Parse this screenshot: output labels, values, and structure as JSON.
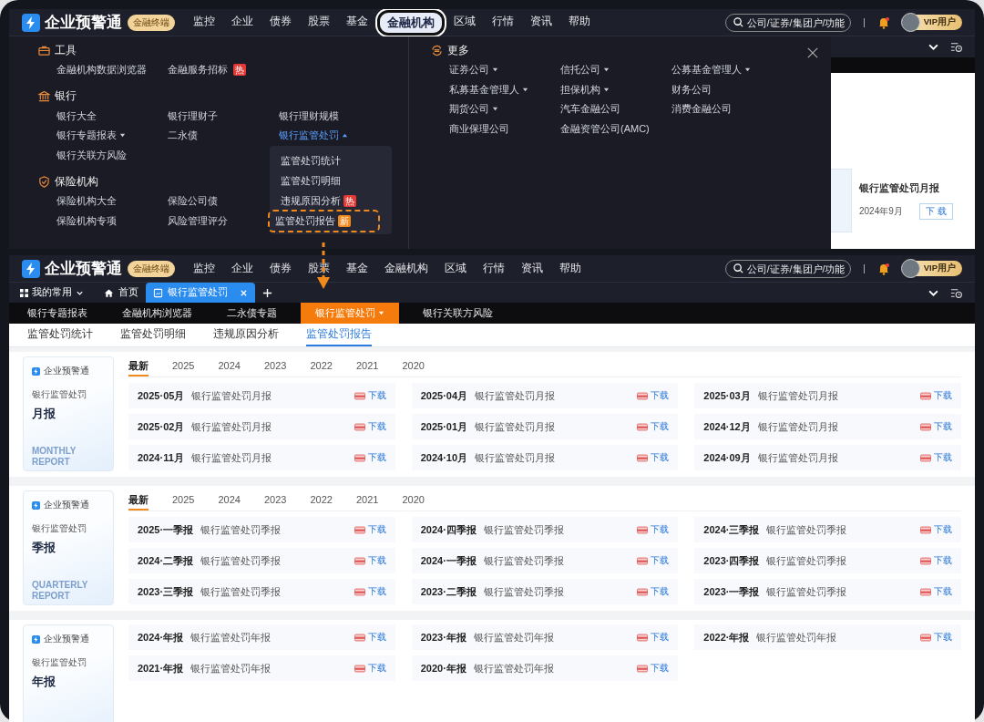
{
  "screens": [
    {
      "header": {
        "logo_text": "企业预警通",
        "badge": "金融终端",
        "nav": [
          {
            "label": "监控",
            "selected": false
          },
          {
            "label": "企业",
            "selected": false
          },
          {
            "label": "债券",
            "selected": false
          },
          {
            "label": "股票",
            "selected": false
          },
          {
            "label": "基金",
            "selected": false
          },
          {
            "label": "金融机构",
            "selected": true
          },
          {
            "label": "区域",
            "selected": false
          },
          {
            "label": "行情",
            "selected": false
          },
          {
            "label": "资讯",
            "selected": false
          },
          {
            "label": "帮助",
            "selected": false
          }
        ],
        "search_placeholder": "公司/证券/集团户/功能",
        "unread": true,
        "user": "VIP用户"
      },
      "mega_menu": {
        "groups": [
          {
            "kind": "tools",
            "title": "工具",
            "rows": [
              [
                {
                  "label": "金融机构数据浏览器",
                  "dropdown": false,
                  "expanded": false
                },
                {
                  "label": "金融服务招标",
                  "dropdown": false,
                  "expanded": false,
                  "badge": {
                    "text": "热",
                    "kind": "hot"
                  }
                }
              ]
            ]
          },
          {
            "kind": "bank",
            "title": "银行",
            "rows": [
              [
                {
                  "label": "银行大全",
                  "dropdown": false,
                  "expanded": false
                },
                {
                  "label": "银行理财子",
                  "dropdown": false,
                  "expanded": false
                },
                {
                  "label": "银行理财规模",
                  "dropdown": false,
                  "expanded": false
                }
              ],
              [
                {
                  "label": "银行专题报表",
                  "dropdown": true,
                  "expanded": false
                },
                {
                  "label": "二永债",
                  "dropdown": false,
                  "expanded": false
                },
                {
                  "label": "银行监管处罚",
                  "dropdown": true,
                  "expanded": true,
                  "submenu": [
                    {
                      "label": "监管处罚统计",
                      "highlighted": false
                    },
                    {
                      "label": "监管处罚明细",
                      "highlighted": false
                    },
                    {
                      "label": "违规原因分析",
                      "highlighted": false,
                      "badge": {
                        "text": "热",
                        "kind": "hot"
                      }
                    },
                    {
                      "label": "监管处罚报告",
                      "highlighted": true,
                      "badge": {
                        "text": "新",
                        "kind": "new"
                      }
                    }
                  ]
                }
              ],
              [
                {
                  "label": "银行关联方风险",
                  "dropdown": false,
                  "expanded": false
                }
              ]
            ]
          },
          {
            "kind": "insurance",
            "title": "保险机构",
            "rows": [
              [
                {
                  "label": "保险机构大全",
                  "dropdown": false,
                  "expanded": false
                },
                {
                  "label": "保险公司债",
                  "dropdown": false,
                  "expanded": false
                }
              ],
              [
                {
                  "label": "保险机构专项",
                  "dropdown": false,
                  "expanded": false
                },
                {
                  "label": "风险管理评分",
                  "dropdown": false,
                  "expanded": false
                }
              ]
            ]
          }
        ],
        "more": {
          "title": "更多",
          "rows": [
            [
              {
                "label": "证券公司",
                "dropdown": true,
                "expanded": false
              },
              {
                "label": "信托公司",
                "dropdown": true,
                "expanded": false
              },
              {
                "label": "公募基金管理人",
                "dropdown": true,
                "expanded": false
              }
            ],
            [
              {
                "label": "私募基金管理人",
                "dropdown": true,
                "expanded": false
              },
              {
                "label": "担保机构",
                "dropdown": true,
                "expanded": false
              },
              {
                "label": "财务公司",
                "dropdown": false,
                "expanded": false
              }
            ],
            [
              {
                "label": "期货公司",
                "dropdown": true,
                "expanded": false
              },
              {
                "label": "汽车金融公司",
                "dropdown": false,
                "expanded": false
              },
              {
                "label": "消费金融公司",
                "dropdown": false,
                "expanded": false
              }
            ],
            [
              {
                "label": "商业保理公司",
                "dropdown": false,
                "expanded": false
              },
              {
                "label": "金融资管公司(AMC)",
                "dropdown": false,
                "expanded": false
              }
            ]
          ]
        }
      },
      "peek": {
        "title": "银行监管处罚月报",
        "date": "2024年9月",
        "button": "下 载"
      }
    },
    {
      "header": {
        "logo_text": "企业预警通",
        "badge": "金融终端",
        "nav": [
          {
            "label": "监控",
            "selected": false
          },
          {
            "label": "企业",
            "selected": false
          },
          {
            "label": "债券",
            "selected": false
          },
          {
            "label": "股票",
            "selected": false
          },
          {
            "label": "基金",
            "selected": false
          },
          {
            "label": "金融机构",
            "selected": false
          },
          {
            "label": "区域",
            "selected": false
          },
          {
            "label": "行情",
            "selected": false
          },
          {
            "label": "资讯",
            "selected": false
          },
          {
            "label": "帮助",
            "selected": false
          }
        ],
        "search_placeholder": "公司/证券/集团户/功能",
        "unread": true,
        "user": "VIP用户"
      },
      "tabbar": {
        "favorites": "我的常用",
        "tabs": [
          {
            "label": "首页",
            "kind": "home",
            "selected": false
          },
          {
            "label": "银行监管处罚",
            "kind": "page",
            "selected": true
          }
        ]
      },
      "subnav": [
        {
          "label": "银行专题报表",
          "selected": false,
          "dropdown": false
        },
        {
          "label": "金融机构浏览器",
          "selected": false,
          "dropdown": false
        },
        {
          "label": "二永债专题",
          "selected": false,
          "dropdown": false
        },
        {
          "label": "银行监管处罚",
          "selected": true,
          "dropdown": true
        },
        {
          "label": "银行关联方风险",
          "selected": false,
          "dropdown": false
        }
      ],
      "subtabs": [
        {
          "label": "监管处罚统计",
          "selected": false
        },
        {
          "label": "监管处罚明细",
          "selected": false
        },
        {
          "label": "违规原因分析",
          "selected": false
        },
        {
          "label": "监管处罚报告",
          "selected": true
        }
      ],
      "sections": [
        {
          "cover": {
            "brand": "企业预警通",
            "title": "银行监管处罚",
            "report_type": "月报",
            "english": "MONTHLY REPORT"
          },
          "years": [
            {
              "label": "最新",
              "selected": true
            },
            {
              "label": "2025",
              "selected": false
            },
            {
              "label": "2024",
              "selected": false
            },
            {
              "label": "2023",
              "selected": false
            },
            {
              "label": "2022",
              "selected": false
            },
            {
              "label": "2021",
              "selected": false
            },
            {
              "label": "2020",
              "selected": false
            }
          ],
          "reports": [
            {
              "period": "2025·05月",
              "title": "银行监管处罚月报",
              "action": "下载"
            },
            {
              "period": "2025·04月",
              "title": "银行监管处罚月报",
              "action": "下载"
            },
            {
              "period": "2025·03月",
              "title": "银行监管处罚月报",
              "action": "下载"
            },
            {
              "period": "2025·02月",
              "title": "银行监管处罚月报",
              "action": "下载"
            },
            {
              "period": "2025·01月",
              "title": "银行监管处罚月报",
              "action": "下载"
            },
            {
              "period": "2024·12月",
              "title": "银行监管处罚月报",
              "action": "下载"
            },
            {
              "period": "2024·11月",
              "title": "银行监管处罚月报",
              "action": "下载"
            },
            {
              "period": "2024·10月",
              "title": "银行监管处罚月报",
              "action": "下载"
            },
            {
              "period": "2024·09月",
              "title": "银行监管处罚月报",
              "action": "下载"
            }
          ]
        },
        {
          "cover": {
            "brand": "企业预警通",
            "title": "银行监管处罚",
            "report_type": "季报",
            "english": "QUARTERLY REPORT"
          },
          "years": [
            {
              "label": "最新",
              "selected": true
            },
            {
              "label": "2025",
              "selected": false
            },
            {
              "label": "2024",
              "selected": false
            },
            {
              "label": "2023",
              "selected": false
            },
            {
              "label": "2022",
              "selected": false
            },
            {
              "label": "2021",
              "selected": false
            },
            {
              "label": "2020",
              "selected": false
            }
          ],
          "reports": [
            {
              "period": "2025·一季报",
              "title": "银行监管处罚季报",
              "action": "下载"
            },
            {
              "period": "2024·四季报",
              "title": "银行监管处罚季报",
              "action": "下载"
            },
            {
              "period": "2024·三季报",
              "title": "银行监管处罚季报",
              "action": "下载"
            },
            {
              "period": "2024·二季报",
              "title": "银行监管处罚季报",
              "action": "下载"
            },
            {
              "period": "2024·一季报",
              "title": "银行监管处罚季报",
              "action": "下载"
            },
            {
              "period": "2023·四季报",
              "title": "银行监管处罚季报",
              "action": "下载"
            },
            {
              "period": "2023·三季报",
              "title": "银行监管处罚季报",
              "action": "下载"
            },
            {
              "period": "2023·二季报",
              "title": "银行监管处罚季报",
              "action": "下载"
            },
            {
              "period": "2023·一季报",
              "title": "银行监管处罚季报",
              "action": "下载"
            }
          ]
        },
        {
          "cover": {
            "brand": "企业预警通",
            "title": "银行监管处罚",
            "report_type": "年报"
          },
          "reports": [
            {
              "period": "2024·年报",
              "title": "银行监管处罚年报",
              "action": "下载"
            },
            {
              "period": "2023·年报",
              "title": "银行监管处罚年报",
              "action": "下载"
            },
            {
              "period": "2022·年报",
              "title": "银行监管处罚年报",
              "action": "下载"
            },
            {
              "period": "2021·年报",
              "title": "银行监管处罚年报",
              "action": "下载"
            },
            {
              "period": "2020·年报",
              "title": "银行监管处罚年报",
              "action": "下载"
            }
          ]
        }
      ]
    }
  ]
}
